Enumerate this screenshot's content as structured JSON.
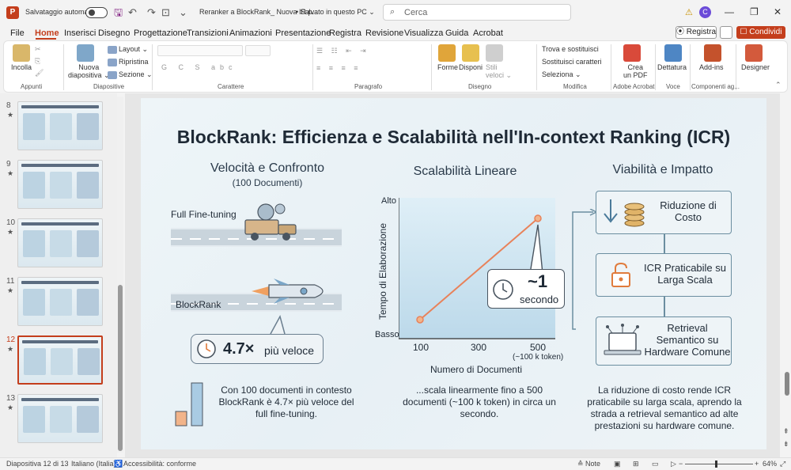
{
  "titlebar": {
    "autosave_label": "Salvataggio automatico",
    "filename": "Reranker a BlockRank_ Nuova IR.p...",
    "save_status": "• Salvato in questo PC ⌄",
    "search_placeholder": "Cerca",
    "avatar": "C"
  },
  "menu": {
    "items": [
      "File",
      "Home",
      "Inserisci",
      "Disegno",
      "Progettazione",
      "Transizioni",
      "Animazioni",
      "Presentazione",
      "Registra",
      "Revisione",
      "Visualizza",
      "Guida",
      "Acrobat"
    ],
    "record_label": "⦿ Registra",
    "share_label": "☐ Condividi ⌄"
  },
  "ribbon": {
    "incolla": "Incolla",
    "nuova_diapositiva": "Nuova\ndiapositiva ⌄",
    "layout": "Layout ⌄",
    "ripristina": "Ripristina",
    "sezione": "Sezione ⌄",
    "forme": "Forme",
    "disponi": "Disponi",
    "stili_veloci": "Stili\nveloci ⌄",
    "trova": "Trova e sostituisci",
    "sostituisci_caratteri": "Sostituisci caratteri",
    "seleziona": "Seleziona ⌄",
    "crea_pdf": "Crea\nun PDF",
    "dettatura": "Dettatura",
    "addins": "Add-ins",
    "designer": "Designer",
    "groups": [
      "Appunti",
      "Diapositive",
      "Carattere",
      "Paragrafo",
      "Disegno",
      "Modifica",
      "Adobe Acrobat",
      "Voce",
      "Componenti ag...",
      ""
    ]
  },
  "thumbnails": [
    {
      "num": "8",
      "title": "In-context Ranking (ICR): Meccanismo di Attenzione"
    },
    {
      "num": "9",
      "title": "Il Loss di BlockRank: InfoNCE sull'Attenzione"
    },
    {
      "num": "10",
      "title": "BlockRank: Efficienza tramite Attention Sparsa e Training Contrastivo"
    },
    {
      "num": "11",
      "title": "Prestazioni di BlockRank: Stato dell'Arte e Oltre"
    },
    {
      "num": "12",
      "title": "BlockRank: Efficienza e Scalabilità nell'In-context Ranking (ICR)"
    },
    {
      "num": "13",
      "title": "BlockRank: Lezioni e Implicazioni Future"
    }
  ],
  "slide": {
    "title": "BlockRank: Efficienza e Scalabilità nell'In-context Ranking (ICR)",
    "col1": {
      "heading": "Velocità e Confronto",
      "sub": "(100 Documenti)",
      "label_full": "Full Fine-tuning",
      "label_block": "BlockRank",
      "speed_value": "4.7×",
      "speed_text": "più veloce",
      "caption": "Con 100 documenti in contesto BlockRank è 4.7× più veloce del full fine-tuning."
    },
    "col2": {
      "heading": "Scalabilità Lineare",
      "y_high": "Alto",
      "y_low": "Basso",
      "ylabel": "Tempo di Elaborazione",
      "xlabel": "Numero di Documenti",
      "ticks": [
        "100",
        "300",
        "500"
      ],
      "tick_note": "(~100 k token)",
      "callout_value": "~1",
      "callout_unit": "secondo",
      "caption": "...scala linearmente fino a 500 documenti (~100 k token) in circa un secondo."
    },
    "col3": {
      "heading": "Viabilità e Impatto",
      "box1": "Riduzione di Costo",
      "box2": "ICR Praticabile su Larga Scala",
      "box3": "Retrieval Semantico su Hardware Comune",
      "caption": "La riduzione di costo rende ICR praticabile su larga scala, aprendo la strada a retrieval semantico ad alte prestazioni su hardware comune."
    }
  },
  "statusbar": {
    "slide_info": "Diapositiva 12 di 13",
    "language": "Italiano (Italia)",
    "accessibility": "Accessibilità: conforme",
    "notes": "≙ Note",
    "zoom": "64%"
  },
  "colors": {
    "accent": "#c43e1c",
    "line": "#e8825a"
  }
}
